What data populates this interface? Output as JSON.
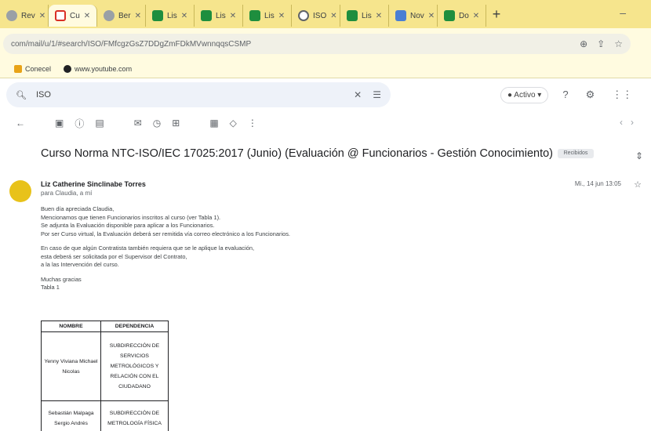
{
  "browser": {
    "tabs": [
      {
        "label": "Rev",
        "favicon": "person-icon",
        "active": false
      },
      {
        "label": "Cu",
        "favicon": "gmail-icon",
        "active": true
      },
      {
        "label": "Ber",
        "favicon": "person-icon",
        "active": false
      },
      {
        "label": "Lis",
        "favicon": "teams-icon",
        "active": false
      },
      {
        "label": "Lis",
        "favicon": "teams-icon",
        "active": false
      },
      {
        "label": "Lis",
        "favicon": "teams-icon",
        "active": false
      },
      {
        "label": "ISO",
        "favicon": "globe-icon",
        "active": false
      },
      {
        "label": "Lis",
        "favicon": "teams-icon",
        "active": false
      },
      {
        "label": "Nov",
        "favicon": "doc-icon",
        "active": false
      },
      {
        "label": "Do",
        "favicon": "teams-icon",
        "active": false
      }
    ],
    "new_tab": "+",
    "url": "com/mail/u/1/#search/ISO/FMfcgzGsZ7DDgZmFDkMVwnnqqsCSMP",
    "bookmarks": [
      "Conecel",
      "www.youtube.com"
    ]
  },
  "gmail": {
    "search_query": "ISO",
    "status_label": "Activo",
    "email": {
      "subject": "Curso Norma NTC-ISO/IEC 17025:2017 (Junio) (Evaluación @ Funcionarios - Gestión Conocimiento)",
      "label_chip": "Recibidos",
      "sender_name": "Liz Catherine Sinclinabe Torres",
      "sender_email": "para Claudia, a mí",
      "date": "Mi., 14 jun 13:05",
      "body_lines": [
        "Buen día apreciada Claudia,",
        "Mencionamos que tienen Funcionarios inscritos al curso (ver Tabla 1).",
        "Se adjunta la Evaluación disponible para aplicar a los Funcionarios.",
        "Por ser Curso virtual, la Evaluación deberá ser remitida vía correo electrónico a los Funcionarios.",
        "",
        "En caso de que algún Contratista también requiera que se le aplique la evaluación,",
        "esta deberá ser solicitada por el Supervisor del Contrato,",
        "a la las Intervención del curso.",
        "",
        "Muchas gracias",
        "Tabla 1"
      ],
      "table": {
        "headers": [
          "NOMBRE",
          "DEPENDENCIA"
        ],
        "rows": [
          {
            "name": "Yenny Viviana Michael Nicolas",
            "dep": "SUBDIRECCIÓN DE SERVICIOS METROLÓGICOS Y RELACIÓN CON EL CIUDADANO"
          },
          {
            "name": "Sebastián Malpaga Sergio Andrés",
            "dep": "SUBDIRECCIÓN DE METROLOGÍA FÍSICA"
          }
        ]
      }
    }
  }
}
